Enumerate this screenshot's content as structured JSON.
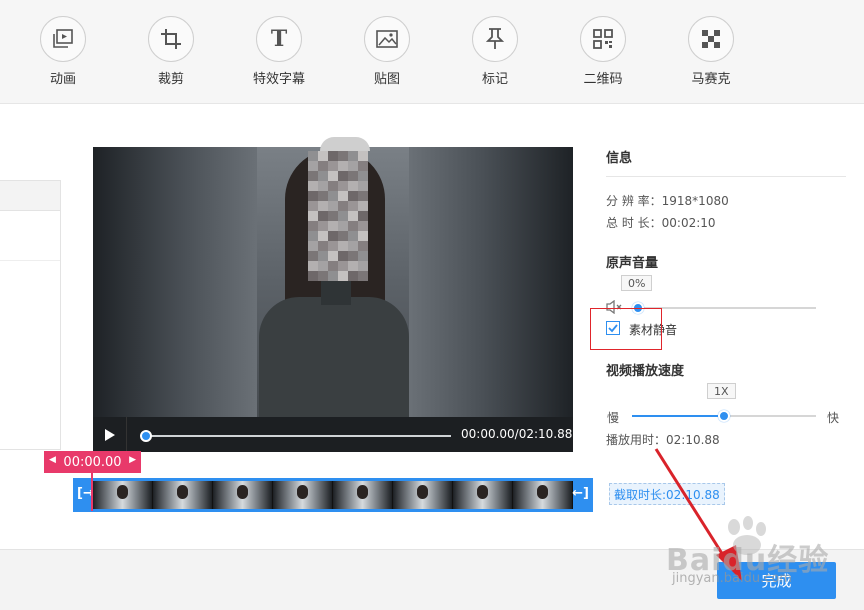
{
  "toolbar": {
    "tools": [
      {
        "label": "动画",
        "icon": "animation-icon"
      },
      {
        "label": "裁剪",
        "icon": "crop-icon"
      },
      {
        "label": "特效字幕",
        "icon": "text-icon"
      },
      {
        "label": "贴图",
        "icon": "image-icon"
      },
      {
        "label": "标记",
        "icon": "pin-icon"
      },
      {
        "label": "二维码",
        "icon": "qrcode-icon"
      },
      {
        "label": "马赛克",
        "icon": "mosaic-icon"
      }
    ]
  },
  "player": {
    "time_display": "00:00.00/02:10.88",
    "progress": 0
  },
  "timeline": {
    "start_time": "00:00.00",
    "clip_length": "截取时长:02:10.88"
  },
  "info": {
    "title": "信息",
    "resolution_label": "分 辨 率：",
    "resolution_value": "1918*1080",
    "duration_label": "总 时 长：",
    "duration_value": "00:02:10"
  },
  "audio": {
    "title": "原声音量",
    "volume_display": "0%",
    "volume": 0,
    "mute_label": "素材静音",
    "mute_checked": true
  },
  "speed": {
    "title": "视频播放速度",
    "value_display": "1X",
    "slow_label": "慢",
    "fast_label": "快",
    "playtime_label": "播放用时：",
    "playtime_value": "02:10.88",
    "level": 0.5
  },
  "footer": {
    "done_label": "完成"
  },
  "watermark": {
    "text": "Baidu经验",
    "url": "jingyan.baidu.com"
  },
  "colors": {
    "accent": "#2e8ff0",
    "marker": "#e8396a",
    "highlight": "#e0252b"
  }
}
